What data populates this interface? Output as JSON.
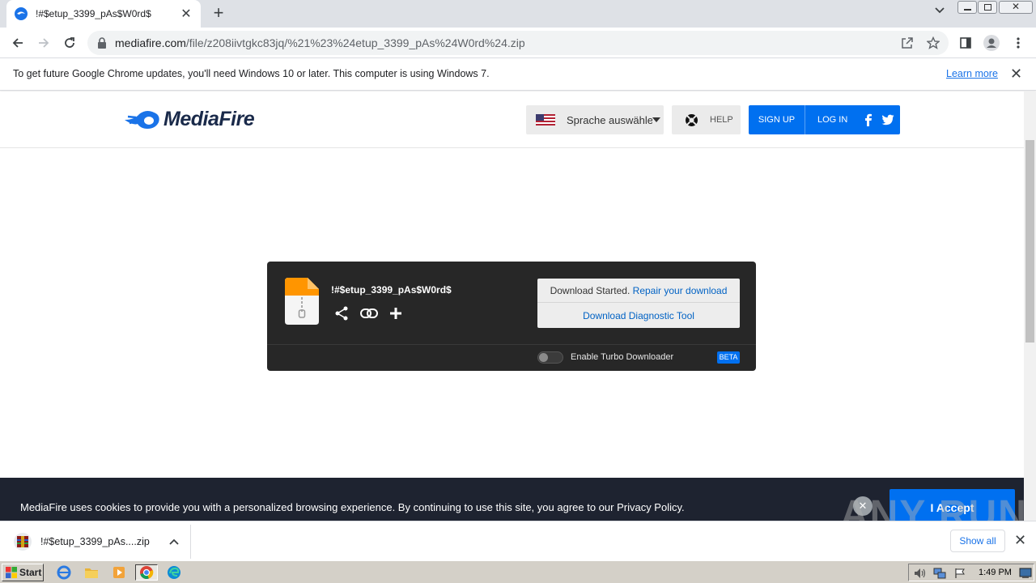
{
  "browser": {
    "tab_title": "!#$etup_3399_pAs$W0rd$",
    "url_host": "mediafire.com",
    "url_path": "/file/z208iivtgkc83jq/%21%23%24etup_3399_pAs%24W0rd%24.zip",
    "infobar_message": "To get future Google Chrome updates, you'll need Windows 10 or later. This computer is using Windows 7.",
    "infobar_link": "Learn more"
  },
  "header": {
    "logo_text": "MediaFire",
    "language_label": "Sprache auswählen",
    "help_label": "HELP",
    "signup_label": "SIGN UP",
    "login_label": "LOG IN"
  },
  "download": {
    "file_name": "!#$etup_3399_pAs$W0rd$",
    "status_text": "Download Started.",
    "repair_link": "Repair your download",
    "diagnostic_link": "Download Diagnostic Tool",
    "turbo_label": "Enable Turbo Downloader",
    "beta_badge": "BETA"
  },
  "cookie": {
    "message": "MediaFire uses cookies to provide you with a personalized browsing experience. By continuing to use this site, you agree to our Privacy Policy.",
    "accept_label": "I Accept"
  },
  "shelf": {
    "item_name": "!#$etup_3399_pAs....zip",
    "show_all": "Show all"
  },
  "watermark": "ANY RUN",
  "taskbar": {
    "start_label": "Start",
    "clock": "1:49 PM"
  },
  "colors": {
    "mediafire_blue": "#0070f0",
    "dark_panel": "#272727",
    "cookie_bg": "#1e2330"
  }
}
